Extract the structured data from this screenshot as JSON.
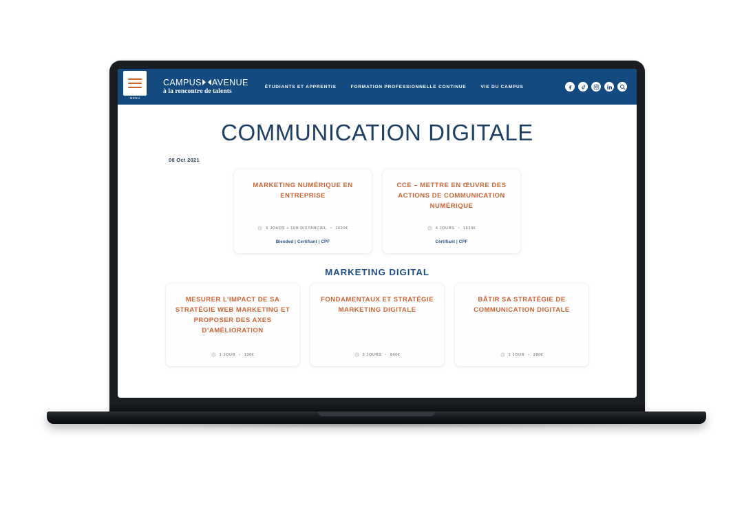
{
  "header": {
    "menu_button": {
      "icon": "hamburger-icon",
      "label": "MENU"
    },
    "brand": {
      "name_part1": "CAMPUS",
      "mark": "diamond-mark",
      "name_part2": "AVENUE",
      "tagline": "à la rencontre de talents"
    },
    "nav_items": [
      {
        "label": "ÉTUDIANTS ET APPRENTIS"
      },
      {
        "label": "FORMATION PROFESSIONNELLE CONTINUE"
      },
      {
        "label": "VIE DU CAMPUS"
      }
    ],
    "social": [
      {
        "name": "facebook-icon",
        "glyph": "f"
      },
      {
        "name": "tiktok-icon",
        "glyph": "♪"
      },
      {
        "name": "instagram-icon",
        "glyph": "◎"
      },
      {
        "name": "linkedin-icon",
        "glyph": "in"
      },
      {
        "name": "search-icon",
        "glyph": "⌕"
      }
    ],
    "colors": {
      "header_bg": "#134a80",
      "accent_orange": "#c8622f"
    }
  },
  "page": {
    "title": "COMMUNICATION DIGITALE",
    "date": "08 Oct 2021",
    "section_heading": "MARKETING DIGITAL",
    "colors": {
      "title": "#1d3f63",
      "card_title": "#cd6433",
      "tag": "#1d4d86",
      "meta": "#8d9196"
    }
  },
  "cards_row1": [
    {
      "title": "MARKETING NUMÉRIQUE EN ENTREPRISE",
      "duration": "6 JOURS + 10H DISTANCIEL",
      "separator": "•",
      "price": "1620€",
      "tags": "Blended | Certifiant | CPF"
    },
    {
      "title": "CCE – METTRE EN ŒUVRE DES ACTIONS DE COMMUNICATION NUMÉRIQUE",
      "duration": "4 JOURS",
      "separator": "•",
      "price": "1620€",
      "tags": "Certifiant | CPF"
    }
  ],
  "cards_row2": [
    {
      "title": "MESURER L’IMPACT DE SA STRATÉGIE WEB MARKETING ET PROPOSER DES AXES D’AMÉLIORATION",
      "duration": "1 JOUR",
      "separator": "•",
      "price": "130€",
      "tags": ""
    },
    {
      "title": "FONDAMENTAUX ET STRATÉGIE MARKETING DIGITALE",
      "duration": "3 JOURS",
      "separator": "•",
      "price": "840€",
      "tags": ""
    },
    {
      "title": "BÂTIR SA STRATÉGIE DE COMMUNICATION DIGITALE",
      "duration": "1 JOUR",
      "separator": "•",
      "price": "280€",
      "tags": ""
    }
  ]
}
